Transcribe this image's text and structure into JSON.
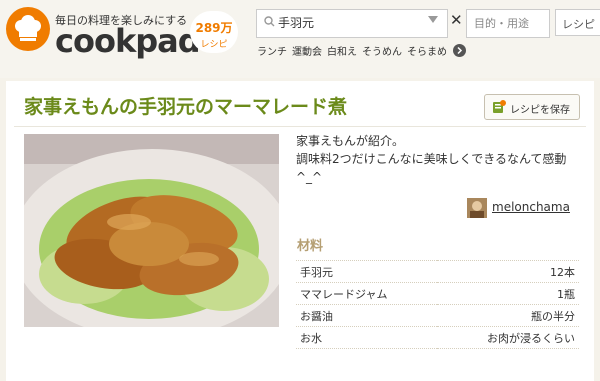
{
  "header": {
    "tagline": "毎日の料理を楽しみにする",
    "brand": "cookpad",
    "recipe_count": "289万",
    "recipe_count_unit": "レシピ",
    "search": {
      "value": "手羽元",
      "purpose_placeholder": "目的・用途",
      "button_label": "レシピ"
    },
    "keywords": [
      "ランチ",
      "運動会",
      "白和え",
      "そうめん",
      "そらまめ"
    ]
  },
  "recipe": {
    "title": "家事えもんの手羽元のマーマレード煮",
    "save_label": "レシピを保存",
    "description": "家事えもんが紹介。\n調味料2つだけこんなに美味しくできるなんて感動^_^",
    "author": "melonchama",
    "ingredients_heading": "材料",
    "ingredients": [
      {
        "name": "手羽元",
        "qty": "12本"
      },
      {
        "name": "ママレードジャム",
        "qty": "1瓶"
      },
      {
        "name": "お醤油",
        "qty": "瓶の半分"
      },
      {
        "name": "お水",
        "qty": "お肉が浸るくらい"
      }
    ]
  },
  "colors": {
    "brand_orange": "#f07c00",
    "title_green": "#6b8a1a",
    "heading_tan": "#b59f73"
  }
}
